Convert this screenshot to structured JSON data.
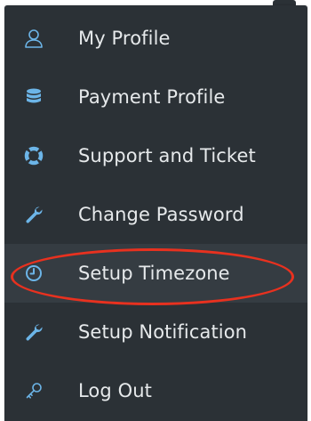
{
  "menu": {
    "items": [
      {
        "label": "My Profile",
        "icon": "user-icon"
      },
      {
        "label": "Payment Profile",
        "icon": "database-icon"
      },
      {
        "label": "Support and Ticket",
        "icon": "life-ring-icon"
      },
      {
        "label": "Change Password",
        "icon": "wrench-icon"
      },
      {
        "label": "Setup Timezone",
        "icon": "clock-icon",
        "active": true
      },
      {
        "label": "Setup Notification",
        "icon": "wrench-icon"
      },
      {
        "label": "Log Out",
        "icon": "key-icon"
      }
    ]
  },
  "colors": {
    "menu_background": "#2b3136",
    "active_background": "#353c42",
    "icon_blue": "#6cb5e8",
    "text": "#e6e9eb",
    "highlight": "#e8311f"
  }
}
